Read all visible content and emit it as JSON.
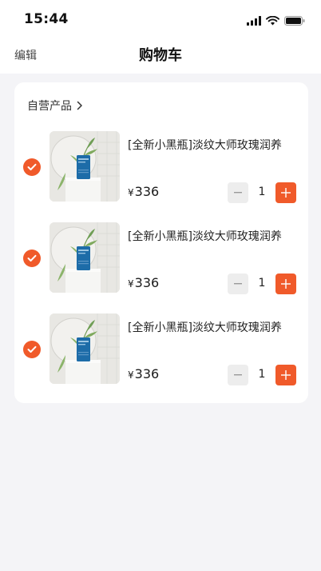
{
  "status_bar": {
    "time": "15:44",
    "icons": [
      "cellular-signal-icon",
      "wifi-icon",
      "battery-icon"
    ]
  },
  "nav": {
    "edit_label": "编辑",
    "title": "购物车"
  },
  "store": {
    "name": "自营产品",
    "icon": "chevron-right-icon"
  },
  "items": [
    {
      "title": "[全新小黑瓶]淡纹大师玫瑰润养",
      "currency": "¥",
      "price": "336",
      "quantity": "1",
      "checked": true
    },
    {
      "title": "[全新小黑瓶]淡纹大师玫瑰润养",
      "currency": "¥",
      "price": "336",
      "quantity": "1",
      "checked": true
    },
    {
      "title": "[全新小黑瓶]淡纹大师玫瑰润养",
      "currency": "¥",
      "price": "336",
      "quantity": "1",
      "checked": true
    }
  ],
  "colors": {
    "accent": "#f05a2a",
    "page_background": "#f4f4f7",
    "card_background": "#ffffff",
    "minus_button": "#ededed"
  }
}
